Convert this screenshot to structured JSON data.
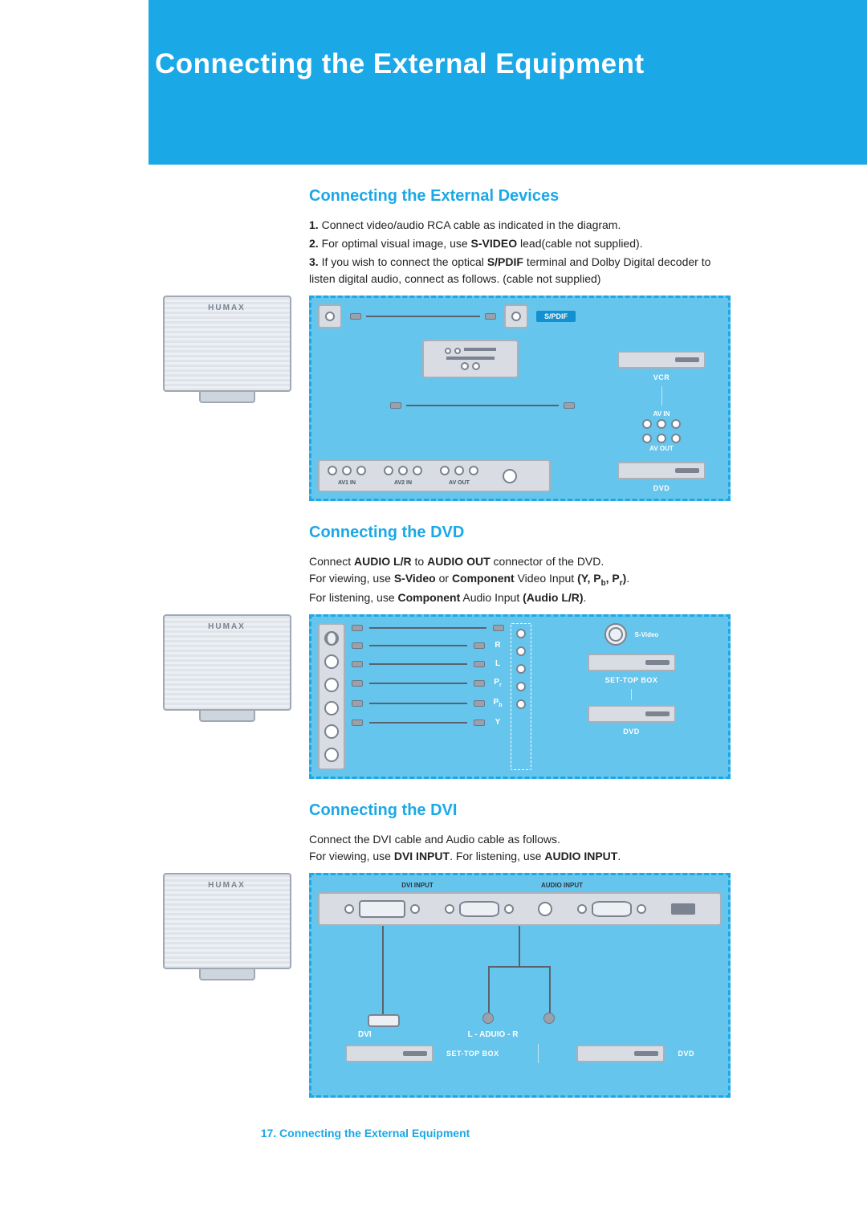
{
  "page": {
    "title": "Connecting the External Equipment",
    "footer": "17. Connecting the External Equipment",
    "tv_brand": "HUMAX"
  },
  "section1": {
    "heading": "Connecting the External Devices",
    "step1_num": "1.",
    "step1_text": " Connect video/audio RCA cable as indicated in the diagram.",
    "step2_num": "2.",
    "step2_pre": " For optimal visual image, use ",
    "step2_bold": "S-VIDEO",
    "step2_post": " lead(cable not supplied).",
    "step3_num": "3.",
    "step3_pre": " If you wish to connect the optical ",
    "step3_bold": "S/PDIF",
    "step3_post": " terminal and Dolby Digital decoder to listen digital audio, connect as follows. (cable not supplied)",
    "labels": {
      "spdif": "S/PDIF",
      "av_in": "AV IN",
      "av_out": "AV OUT",
      "av1_in": "AV1 IN",
      "av2_in": "AV2 IN",
      "av_out_bottom": "AV OUT",
      "vcr": "VCR",
      "dvd": "DVD"
    }
  },
  "section2": {
    "heading": "Connecting the DVD",
    "line1_pre": "Connect ",
    "line1_b1": "AUDIO L/R",
    "line1_mid": " to ",
    "line1_b2": "AUDIO OUT",
    "line1_post": " connector of the DVD.",
    "line2_pre": "For viewing, use ",
    "line2_b1": "S-Video",
    "line2_mid1": " or ",
    "line2_b2": "Component",
    "line2_mid2": " Video Input ",
    "line2_b3": "(Y, Pb, Pr)",
    "line2_post": ".",
    "line3_pre": "For listening, use ",
    "line3_b1": "Component",
    "line3_mid": " Audio Input ",
    "line3_b2": "(Audio L/R)",
    "line3_post": ".",
    "labels": {
      "svideo": "S-Video",
      "R": "R",
      "L": "L",
      "Pr": "Pr",
      "Pb": "Pb",
      "Y": "Y",
      "set_top_box": "SET-TOP BOX",
      "dvd": "DVD"
    }
  },
  "section3": {
    "heading": "Connecting the DVI",
    "line1": "Connect the DVI cable and Audio cable as follows.",
    "line2_pre": "For viewing, use ",
    "line2_b1": "DVI INPUT",
    "line2_mid": ". For listening, use ",
    "line2_b2": "AUDIO INPUT",
    "line2_post": ".",
    "labels": {
      "dvi_input": "DVI INPUT",
      "audio_input": "AUDIO INPUT",
      "dvi": "DVI",
      "audio_lr": "L - ADUIO - R",
      "set_top_box": "SET-TOP BOX",
      "dvd": "DVD"
    }
  }
}
